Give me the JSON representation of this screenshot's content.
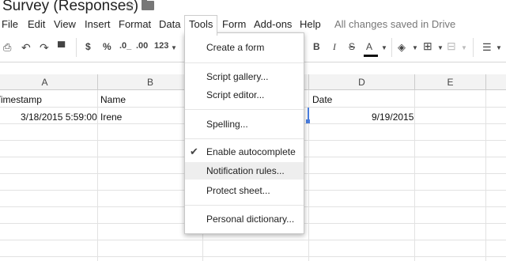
{
  "app": {
    "title": "Survey (Responses)",
    "save_status": "All changes saved in Drive"
  },
  "menu": [
    "File",
    "Edit",
    "View",
    "Insert",
    "Format",
    "Data",
    "Tools",
    "Form",
    "Add-ons",
    "Help"
  ],
  "toolbar": {
    "currency": "$",
    "percent": "%",
    "decimal_decrease": ".0_",
    "decimal_increase": ".00",
    "number_format": "123",
    "bold": "B",
    "italic": "I",
    "strikethrough": "S",
    "text_color": "A"
  },
  "columns": [
    "A",
    "B",
    "C",
    "D",
    "E"
  ],
  "rows": [
    {
      "a": "Timestamp",
      "b": "Name",
      "d": "Date"
    },
    {
      "a": "3/18/2015 5:59:00",
      "b": "Irene",
      "d": "9/19/2015"
    }
  ],
  "tools_menu": {
    "items": [
      "Create a form",
      "Script gallery...",
      "Script editor...",
      "Spelling...",
      "Enable autocomplete",
      "Notification rules...",
      "Protect sheet...",
      "Personal dictionary..."
    ],
    "checked": "Enable autocomplete",
    "highlighted": "Notification rules..."
  }
}
